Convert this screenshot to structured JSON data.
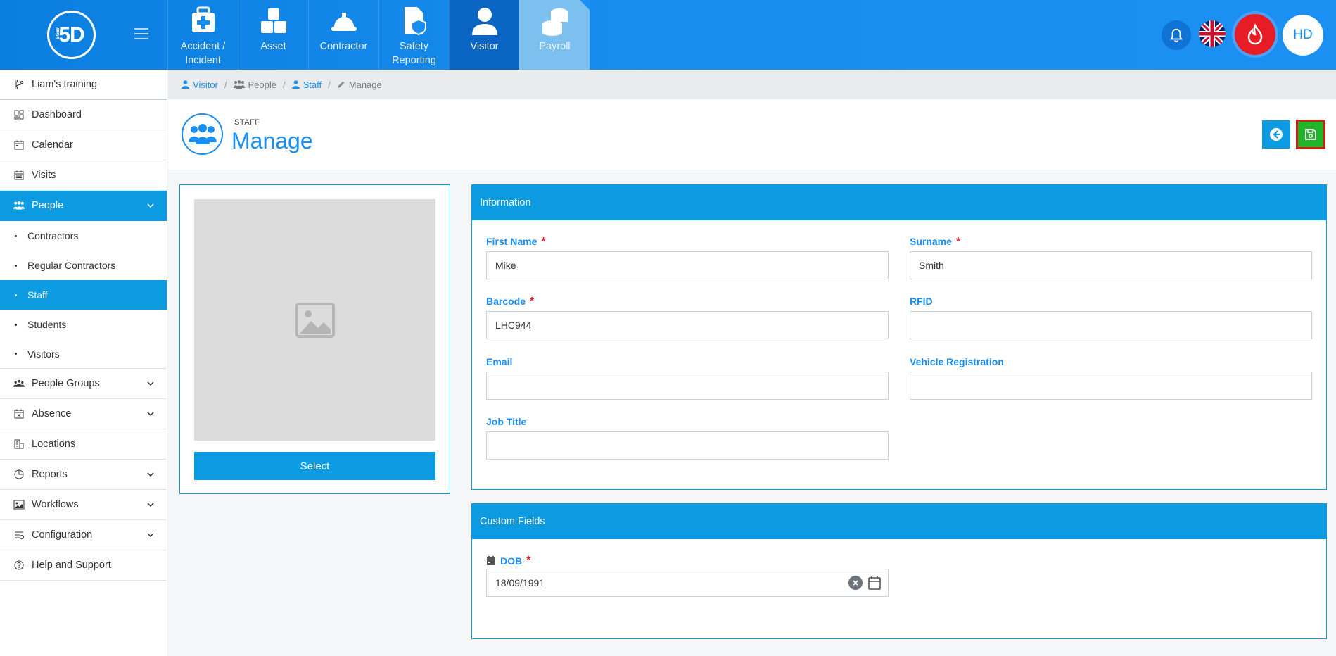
{
  "app": {
    "logo_text": "5D",
    "logo_small": "SGW"
  },
  "modules": [
    {
      "label": "Accident / Incident",
      "icon": "first-aid-kit-icon"
    },
    {
      "label": "Asset",
      "icon": "boxes-icon"
    },
    {
      "label": "Contractor",
      "icon": "hard-hat-icon"
    },
    {
      "label": "Safety Reporting",
      "icon": "file-shield-icon"
    },
    {
      "label": "Visitor",
      "icon": "user-icon"
    },
    {
      "label": "Payroll",
      "icon": "coins-icon"
    }
  ],
  "user": {
    "initials": "HD"
  },
  "sidebar": {
    "items": [
      {
        "label": "Liam's training",
        "icon": "branch-icon"
      },
      {
        "label": "Dashboard",
        "icon": "dashboard-icon"
      },
      {
        "label": "Calendar",
        "icon": "calendar-icon"
      },
      {
        "label": "Visits",
        "icon": "calendar-icon"
      },
      {
        "label": "People",
        "icon": "people-icon"
      },
      {
        "label": "People Groups",
        "icon": "group-icon"
      },
      {
        "label": "Absence",
        "icon": "calendar-x-icon"
      },
      {
        "label": "Locations",
        "icon": "building-icon"
      },
      {
        "label": "Reports",
        "icon": "pie-chart-icon"
      },
      {
        "label": "Workflows",
        "icon": "image-icon"
      },
      {
        "label": "Configuration",
        "icon": "sliders-icon"
      },
      {
        "label": "Help and Support",
        "icon": "help-icon"
      }
    ],
    "people_sub": [
      {
        "label": "Contractors"
      },
      {
        "label": "Regular Contractors"
      },
      {
        "label": "Staff"
      },
      {
        "label": "Students"
      },
      {
        "label": "Visitors"
      }
    ]
  },
  "breadcrumb": [
    {
      "label": "Visitor"
    },
    {
      "label": "People"
    },
    {
      "label": "Staff"
    },
    {
      "label": "Manage"
    }
  ],
  "header": {
    "subtitle": "STAFF",
    "title": "Manage"
  },
  "photo": {
    "select_label": "Select"
  },
  "information": {
    "title": "Information",
    "fields": {
      "first_name": {
        "label": "First Name",
        "value": "Mike",
        "required": "*"
      },
      "surname": {
        "label": "Surname",
        "value": "Smith",
        "required": "*"
      },
      "barcode": {
        "label": "Barcode",
        "value": "LHC944",
        "required": "*"
      },
      "rfid": {
        "label": "RFID",
        "value": ""
      },
      "email": {
        "label": "Email",
        "value": ""
      },
      "vehicle": {
        "label": "Vehicle Registration",
        "value": ""
      },
      "job_title": {
        "label": "Job Title",
        "value": ""
      }
    }
  },
  "custom": {
    "title": "Custom Fields",
    "dob": {
      "label": "DOB",
      "value": "18/09/1991",
      "required": "*"
    }
  },
  "colors": {
    "primary": "#0c9be0",
    "accent": "#1a8ef0",
    "save": "#22b52a",
    "fire": "#e81c24"
  }
}
